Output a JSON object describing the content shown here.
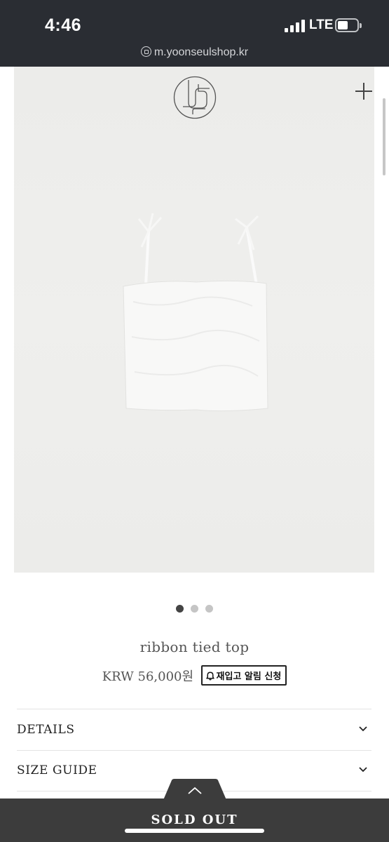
{
  "status": {
    "time": "4:46",
    "network": "LTE",
    "url": "m.yoonseulshop.kr"
  },
  "icons": {
    "logo": "yoonseul-monogram-logo",
    "menu": "plus-icon",
    "bell": "bell-icon",
    "chevron": "chevron-down-icon",
    "up": "chevron-up-icon"
  },
  "gallery": {
    "slides": 3,
    "active_slide": 1
  },
  "product": {
    "name": "ribbon tied top",
    "price": "KRW 56,000원",
    "notify_label": "재입고 알림 신청"
  },
  "accordion": [
    {
      "label": "DETAILS"
    },
    {
      "label": "SIZE GUIDE"
    }
  ],
  "footer": {
    "status_label": "SOLD OUT"
  },
  "colors": {
    "status_bar": "#2a2d33",
    "soldout_bar": "#3c3c3c",
    "photo_bg": "#ececea"
  }
}
